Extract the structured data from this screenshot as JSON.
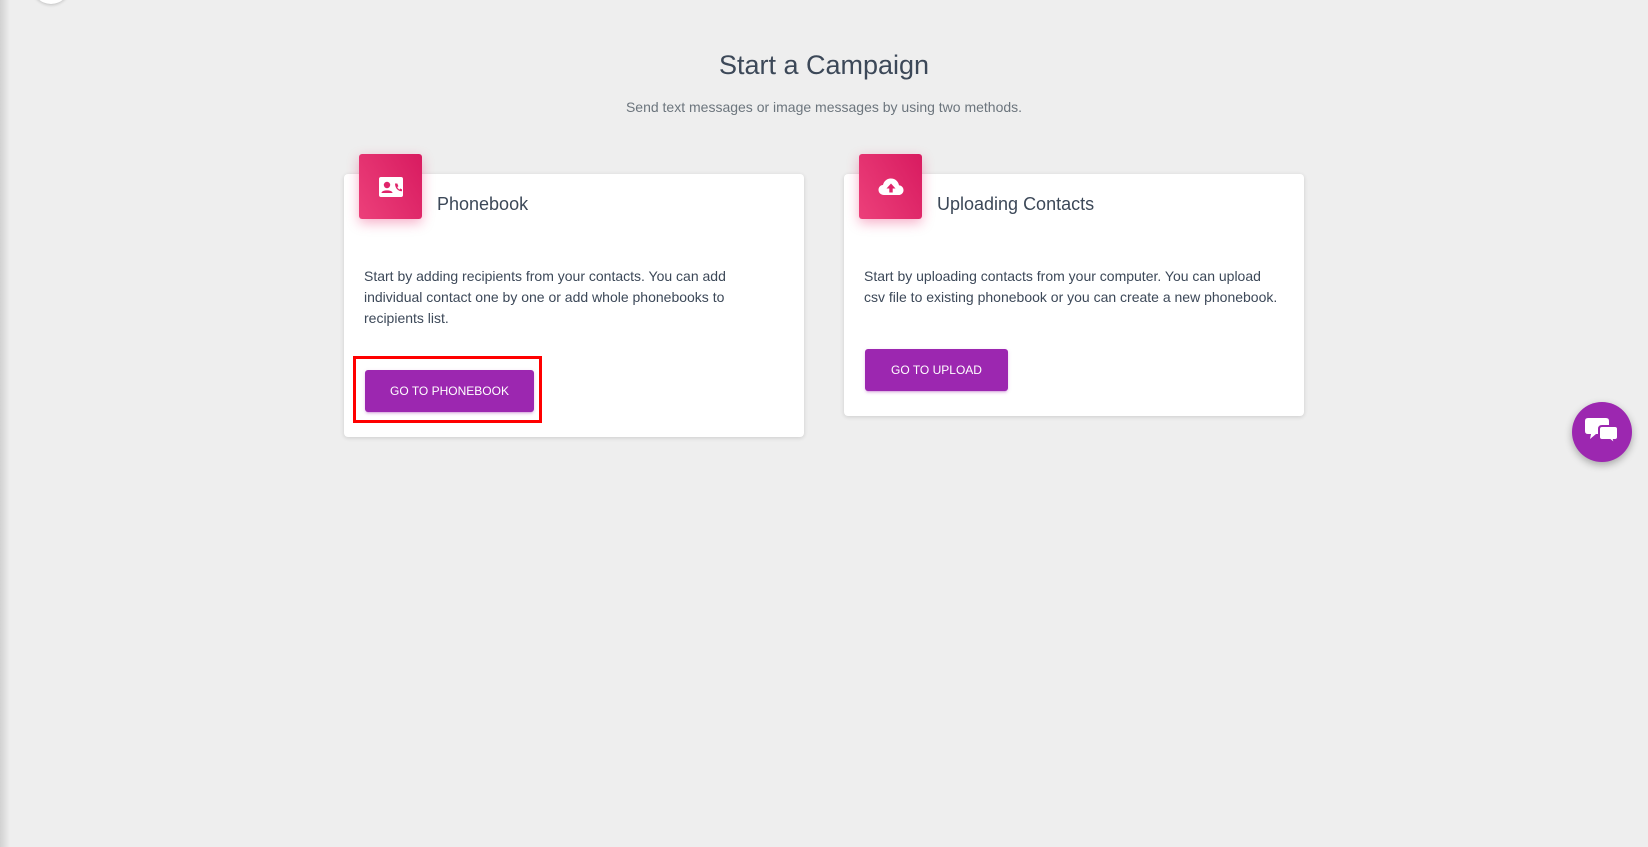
{
  "header": {
    "title": "Start a Campaign",
    "subtitle": "Send text messages or image messages by using two methods."
  },
  "cards": [
    {
      "icon": "contact-card-icon",
      "title": "Phonebook",
      "text": "Start by adding recipients from your contacts. You can add individual contact one by one or add whole phonebooks to recipients list.",
      "button_label": "GO TO PHONEBOOK"
    },
    {
      "icon": "cloud-upload-icon",
      "title": "Uploading Contacts",
      "text": "Start by uploading contacts from your computer. You can upload csv file to existing phonebook or you can create a new phonebook.",
      "button_label": "GO TO UPLOAD"
    }
  ],
  "chat_widget": {
    "icon": "chat-bubbles-icon"
  },
  "colors": {
    "background": "#eeeeee",
    "accent_purple": "#9c27b0",
    "icon_pink": "#e91e63",
    "highlight_red": "#ff0000"
  }
}
